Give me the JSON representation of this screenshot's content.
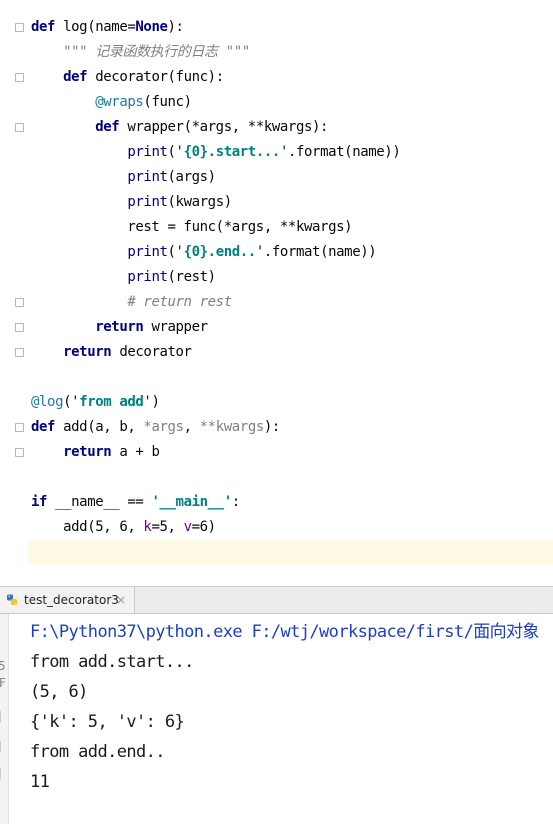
{
  "editor": {
    "lines": [
      {
        "segments": [
          {
            "t": "def ",
            "c": "kw"
          },
          {
            "t": "log",
            "c": ""
          },
          {
            "t": "(name=",
            "c": ""
          },
          {
            "t": "None",
            "c": "kw"
          },
          {
            "t": "):",
            "c": ""
          }
        ]
      },
      {
        "segments": [
          {
            "t": "    ",
            "c": ""
          },
          {
            "t": "\"\"\" 记录函数执行的日志 \"\"\"",
            "c": "doc"
          }
        ]
      },
      {
        "segments": [
          {
            "t": "    ",
            "c": ""
          },
          {
            "t": "def ",
            "c": "kw"
          },
          {
            "t": "decorator",
            "c": ""
          },
          {
            "t": "(func):",
            "c": ""
          }
        ]
      },
      {
        "segments": [
          {
            "t": "        ",
            "c": ""
          },
          {
            "t": "@wraps",
            "c": "deco"
          },
          {
            "t": "(func)",
            "c": ""
          }
        ]
      },
      {
        "segments": [
          {
            "t": "        ",
            "c": ""
          },
          {
            "t": "def ",
            "c": "kw"
          },
          {
            "t": "wrapper",
            "c": ""
          },
          {
            "t": "(*args, **kwargs):",
            "c": ""
          }
        ]
      },
      {
        "segments": [
          {
            "t": "            ",
            "c": ""
          },
          {
            "t": "print",
            "c": "builtin"
          },
          {
            "t": "('",
            "c": ""
          },
          {
            "t": "{0}.start...",
            "c": "str"
          },
          {
            "t": "'.format(name))",
            "c": ""
          }
        ]
      },
      {
        "segments": [
          {
            "t": "            ",
            "c": ""
          },
          {
            "t": "print",
            "c": "builtin"
          },
          {
            "t": "(args)",
            "c": ""
          }
        ]
      },
      {
        "segments": [
          {
            "t": "            ",
            "c": ""
          },
          {
            "t": "print",
            "c": "builtin"
          },
          {
            "t": "(kwargs)",
            "c": ""
          }
        ]
      },
      {
        "segments": [
          {
            "t": "            rest = func(*args, **kwargs)",
            "c": ""
          }
        ]
      },
      {
        "segments": [
          {
            "t": "            ",
            "c": ""
          },
          {
            "t": "print",
            "c": "builtin"
          },
          {
            "t": "('",
            "c": ""
          },
          {
            "t": "{0}.end..",
            "c": "str"
          },
          {
            "t": "'.format(name))",
            "c": ""
          }
        ]
      },
      {
        "segments": [
          {
            "t": "            ",
            "c": ""
          },
          {
            "t": "print",
            "c": "builtin"
          },
          {
            "t": "(rest)",
            "c": ""
          }
        ]
      },
      {
        "segments": [
          {
            "t": "            ",
            "c": ""
          },
          {
            "t": "# return rest",
            "c": "comment"
          }
        ]
      },
      {
        "segments": [
          {
            "t": "        ",
            "c": ""
          },
          {
            "t": "return ",
            "c": "kw"
          },
          {
            "t": "wrapper",
            "c": ""
          }
        ]
      },
      {
        "segments": [
          {
            "t": "    ",
            "c": ""
          },
          {
            "t": "return ",
            "c": "kw"
          },
          {
            "t": "decorator",
            "c": ""
          }
        ]
      },
      {
        "segments": []
      },
      {
        "segments": [
          {
            "t": "@log",
            "c": "deco"
          },
          {
            "t": "('",
            "c": ""
          },
          {
            "t": "from add",
            "c": "str"
          },
          {
            "t": "')",
            "c": ""
          }
        ]
      },
      {
        "segments": [
          {
            "t": "def ",
            "c": "kw"
          },
          {
            "t": "add",
            "c": ""
          },
          {
            "t": "(a, b, ",
            "c": ""
          },
          {
            "t": "*args",
            "c": "muted"
          },
          {
            "t": ", ",
            "c": ""
          },
          {
            "t": "**kwargs",
            "c": "muted"
          },
          {
            "t": "):",
            "c": ""
          }
        ]
      },
      {
        "segments": [
          {
            "t": "    ",
            "c": ""
          },
          {
            "t": "return ",
            "c": "kw"
          },
          {
            "t": "a + b",
            "c": ""
          }
        ]
      },
      {
        "segments": []
      },
      {
        "segments": [
          {
            "t": "if ",
            "c": "kw"
          },
          {
            "t": "__name__ == ",
            "c": ""
          },
          {
            "t": "'__main__'",
            "c": "str"
          },
          {
            "t": ":",
            "c": ""
          }
        ]
      },
      {
        "segments": [
          {
            "t": "    add(5, 6, ",
            "c": ""
          },
          {
            "t": "k",
            "c": "named-arg"
          },
          {
            "t": "=5, ",
            "c": ""
          },
          {
            "t": "v",
            "c": "named-arg"
          },
          {
            "t": "=6)",
            "c": ""
          }
        ]
      }
    ]
  },
  "run": {
    "tab_label": "test_decorator3",
    "close_glyph": "×",
    "console": [
      "F:\\Python37\\python.exe F:/wtj/workspace/first/面向对象",
      "from add.start...",
      "(5, 6)",
      "{'k': 5, 'v': 6}",
      "from add.end..",
      "11"
    ]
  }
}
